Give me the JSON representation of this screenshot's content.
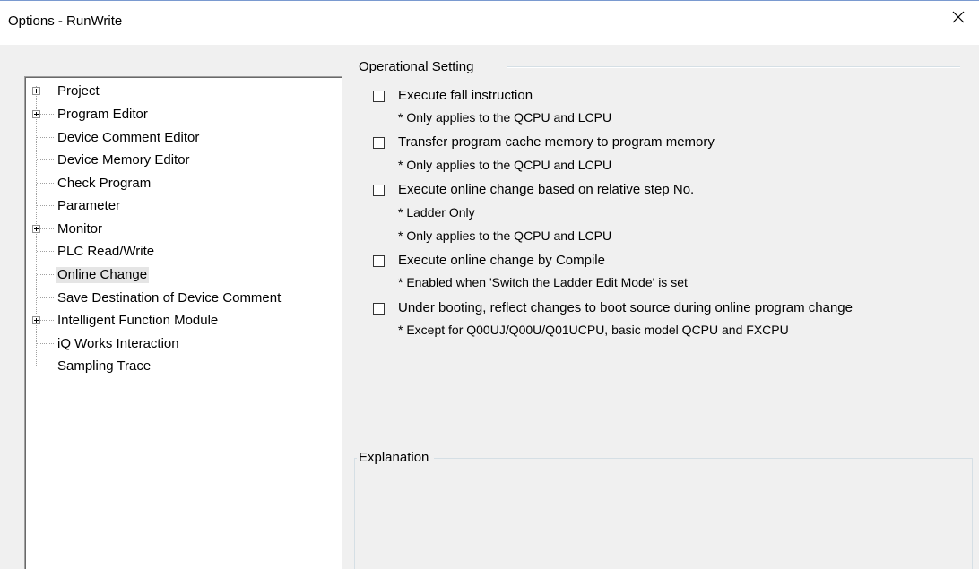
{
  "window": {
    "title": "Options - RunWrite"
  },
  "tree": {
    "items": [
      {
        "label": "Project",
        "expandable": true
      },
      {
        "label": "Program Editor",
        "expandable": true
      },
      {
        "label": "Device Comment Editor",
        "expandable": false
      },
      {
        "label": "Device Memory Editor",
        "expandable": false
      },
      {
        "label": "Check Program",
        "expandable": false
      },
      {
        "label": "Parameter",
        "expandable": false
      },
      {
        "label": "Monitor",
        "expandable": true
      },
      {
        "label": "PLC Read/Write",
        "expandable": false
      },
      {
        "label": "Online Change",
        "expandable": false,
        "selected": true
      },
      {
        "label": "Save Destination of Device Comment",
        "expandable": false
      },
      {
        "label": "Intelligent Function Module",
        "expandable": true
      },
      {
        "label": "iQ Works Interaction",
        "expandable": false
      },
      {
        "label": "Sampling Trace",
        "expandable": false
      }
    ]
  },
  "operational": {
    "title": "Operational Setting",
    "options": [
      {
        "label": "Execute fall instruction",
        "checked": false,
        "notes": [
          "* Only applies to the QCPU and LCPU"
        ]
      },
      {
        "label": "Transfer program cache memory to program memory",
        "checked": false,
        "notes": [
          "* Only applies to the QCPU and LCPU"
        ]
      },
      {
        "label": "Execute online change based on relative step No.",
        "checked": false,
        "notes": [
          "* Ladder Only",
          "* Only applies to the QCPU and LCPU"
        ]
      },
      {
        "label": "Execute online change by Compile",
        "checked": false,
        "notes": [
          "* Enabled when 'Switch the Ladder Edit Mode' is set"
        ]
      },
      {
        "label": "Under booting, reflect changes to boot source during online program change",
        "checked": false,
        "notes": [
          "* Except for Q00UJ/Q00U/Q01UCPU, basic model QCPU and FXCPU"
        ]
      }
    ]
  },
  "explanation": {
    "title": "Explanation"
  }
}
